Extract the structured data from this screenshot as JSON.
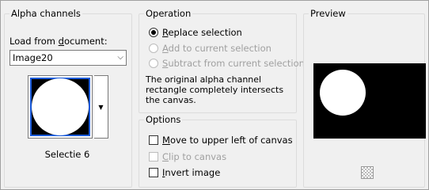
{
  "alpha_channels": {
    "title": "Alpha channels",
    "load_label_pre": "Load from ",
    "load_label_u": "d",
    "load_label_post": "ocument:",
    "document_value": "Image20",
    "selection_caption": "Selectie 6"
  },
  "operation": {
    "title": "Operation",
    "replace_u": "R",
    "replace_rest": "eplace selection",
    "add_u": "A",
    "add_rest": "dd to current selection",
    "subtract_u": "S",
    "subtract_rest": "ubtract from current selection",
    "selected": "replace",
    "info_text": "The original alpha channel rectangle completely intersects the canvas."
  },
  "options": {
    "title": "Options",
    "move_u": "M",
    "move_rest": "ove to upper left of canvas",
    "clip_u": "C",
    "clip_rest": "lip to canvas",
    "invert_u": "I",
    "invert_rest": "nvert image"
  },
  "preview": {
    "title": "Preview"
  },
  "icons": {
    "dropdown": "chevron-down-icon",
    "transparency": "checkerboard-icon"
  },
  "colors": {
    "selection_border": "#1a5ad8",
    "disabled_text": "#a0a0a0"
  }
}
